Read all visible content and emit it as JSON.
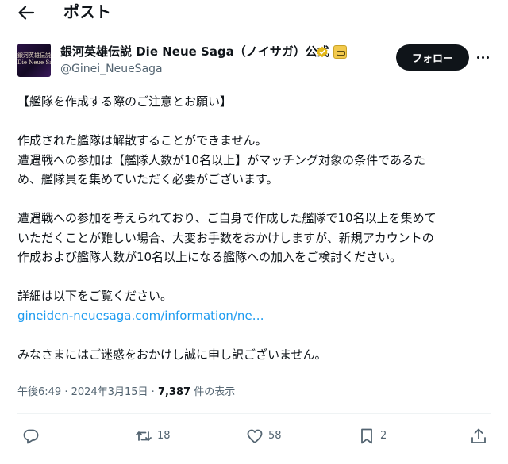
{
  "header": {
    "title": "ポスト"
  },
  "author": {
    "name": "銀河英雄伝説 Die Neue Saga（ノイサガ）公式",
    "handle": "@Ginei_NeueSaga",
    "avatar_logo_line1": "銀河英雄伝説",
    "avatar_logo_line2": "Die Neue Saga"
  },
  "follow_label": "フォロー",
  "tweet": {
    "lines": [
      "【艦隊を作成する際のご注意とお願い】",
      "",
      "作成された艦隊は解散することができません。",
      "遭遇戦への参加は【艦隊人数が10名以上】がマッチング対象の条件であるた",
      "め、艦隊員を集めていただく必要がございます。",
      "",
      "遭遇戦への参加を考えられており、ご自身で作成した艦隊で10名以上を集めて",
      "いただくことが難しい場合、大変お手数をおかけしますが、新規アカウントの",
      "作成および艦隊人数が10名以上になる艦隊への加入をご検討ください。",
      "",
      "詳細は以下をご覧ください。"
    ],
    "link": "gineiden-neuesaga.com/information/ne…",
    "closing": "みなさまにはご迷惑をおかけし誠に申し訳ございません。"
  },
  "meta": {
    "time": "午後6:49",
    "separator": "·",
    "date": "2024年3月15日",
    "views_count": "7,387",
    "views_label": "件の表示"
  },
  "actions": {
    "reply_count": "",
    "repost_count": "18",
    "like_count": "58",
    "bookmark_count": "2"
  },
  "icons": {
    "back": "arrow-left-icon",
    "verified": "verified-badge-icon",
    "affiliate": "affiliate-badge-icon",
    "more": "more-horizontal-icon",
    "reply": "reply-icon",
    "repost": "repost-icon",
    "like": "heart-icon",
    "bookmark": "bookmark-icon",
    "share": "share-icon"
  },
  "colors": {
    "text": "#0f1419",
    "secondary": "#536471",
    "link": "#1d9bf0",
    "verified": "#e2b719",
    "follow_bg": "#0f1419",
    "divider": "#eff3f4"
  }
}
